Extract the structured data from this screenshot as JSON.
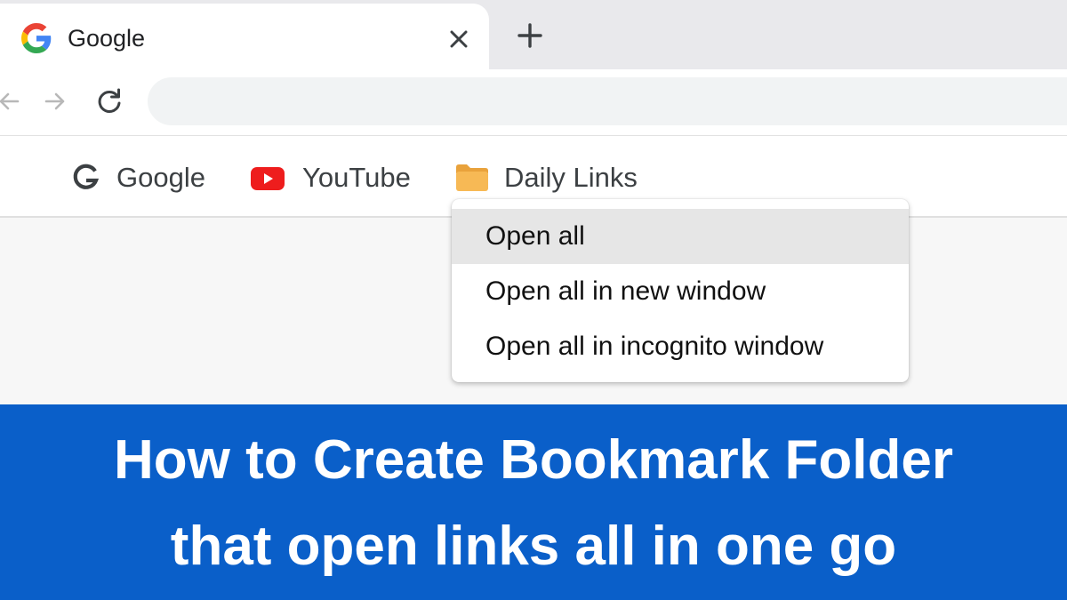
{
  "browser": {
    "tab": {
      "title": "Google",
      "favicon": "google-g-icon",
      "close_icon": "close-icon"
    },
    "new_tab_icon": "plus-icon",
    "toolbar": {
      "back_icon": "arrow-left-icon",
      "forward_icon": "arrow-right-icon",
      "reload_icon": "reload-icon",
      "address_value": ""
    },
    "bookmarks": [
      {
        "label": "Google",
        "icon": "google-g-icon"
      },
      {
        "label": "YouTube",
        "icon": "youtube-icon"
      },
      {
        "label": "Daily Links",
        "icon": "folder-icon"
      }
    ],
    "context_menu": {
      "items": [
        {
          "label": "Open all",
          "highlighted": true
        },
        {
          "label": "Open all in new window",
          "highlighted": false
        },
        {
          "label": "Open all in incognito window",
          "highlighted": false
        }
      ]
    }
  },
  "banner": {
    "line1": "How to Create Bookmark Folder",
    "line2": "that open links all in one go"
  },
  "colors": {
    "banner_bg": "#0a5fc9",
    "folder": "#f7b955",
    "youtube_red": "#ee1d1d",
    "menu_highlight": "#e6e6e6"
  }
}
